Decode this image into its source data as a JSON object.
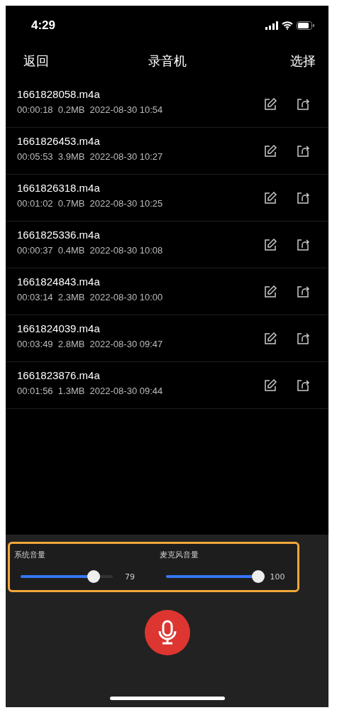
{
  "status_bar": {
    "time": "4:29"
  },
  "nav": {
    "back": "返回",
    "title": "录音机",
    "select": "选择"
  },
  "recordings": [
    {
      "name": "1661828058.m4a",
      "duration": "00:00:18",
      "size": "0.2MB",
      "date": "2022-08-30 10:54"
    },
    {
      "name": "1661826453.m4a",
      "duration": "00:05:53",
      "size": "3.9MB",
      "date": "2022-08-30 10:27"
    },
    {
      "name": "1661826318.m4a",
      "duration": "00:01:02",
      "size": "0.7MB",
      "date": "2022-08-30 10:25"
    },
    {
      "name": "1661825336.m4a",
      "duration": "00:00:37",
      "size": "0.4MB",
      "date": "2022-08-30 10:08"
    },
    {
      "name": "1661824843.m4a",
      "duration": "00:03:14",
      "size": "2.3MB",
      "date": "2022-08-30 10:00"
    },
    {
      "name": "1661824039.m4a",
      "duration": "00:03:49",
      "size": "2.8MB",
      "date": "2022-08-30 09:47"
    },
    {
      "name": "1661823876.m4a",
      "duration": "00:01:56",
      "size": "1.3MB",
      "date": "2022-08-30 09:44"
    }
  ],
  "volume": [
    {
      "label": "系统音量",
      "level": 0.79,
      "reading": "79"
    },
    {
      "label": "麦克风音量",
      "level": 1,
      "reading": "100"
    }
  ]
}
